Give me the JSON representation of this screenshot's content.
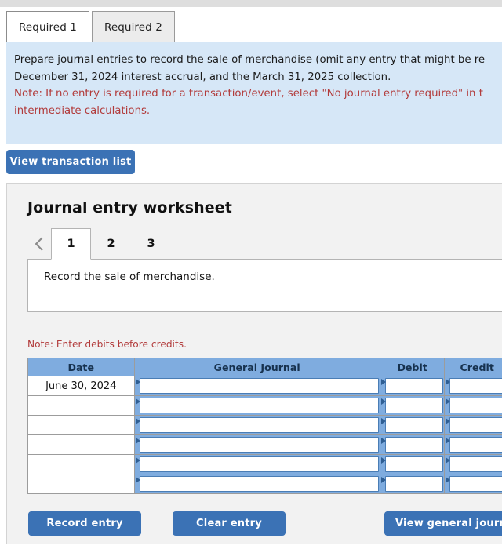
{
  "top_strip": {
    "color": "#dedede"
  },
  "required_tabs": [
    {
      "label": "Required 1",
      "active": true
    },
    {
      "label": "Required 2",
      "active": false
    }
  ],
  "instructions": {
    "background": "#d6e7f7",
    "line1": "Prepare journal entries to record the sale of merchandise (omit any entry that might be re",
    "line2": "December 31, 2024 interest accrual, and the March 31, 2025 collection.",
    "note_line1": "Note: If no entry is required for a transaction/event, select \"No journal entry required\" in t",
    "note_line2": "intermediate calculations.",
    "note_color": "#b23b3b"
  },
  "transaction_button": {
    "label": "View transaction list",
    "color": "#3b72b5"
  },
  "worksheet": {
    "title": "Journal entry worksheet",
    "chevron_icon": "chevron-left-icon",
    "number_tabs": [
      {
        "label": "1",
        "active": true
      },
      {
        "label": "2",
        "active": false
      },
      {
        "label": "3",
        "active": false
      }
    ],
    "description": "Record the sale of merchandise.",
    "note_debits": "Note: Enter debits before credits.",
    "table": {
      "headers": [
        "Date",
        "General Journal",
        "Debit",
        "Credit"
      ],
      "header_bg": "#7facdf",
      "rows": [
        {
          "date": "June 30, 2024",
          "general_journal": "",
          "debit": "",
          "credit": ""
        },
        {
          "date": "",
          "general_journal": "",
          "debit": "",
          "credit": ""
        },
        {
          "date": "",
          "general_journal": "",
          "debit": "",
          "credit": ""
        },
        {
          "date": "",
          "general_journal": "",
          "debit": "",
          "credit": ""
        },
        {
          "date": "",
          "general_journal": "",
          "debit": "",
          "credit": ""
        },
        {
          "date": "",
          "general_journal": "",
          "debit": "",
          "credit": ""
        }
      ]
    },
    "buttons": {
      "record": "Record entry",
      "clear": "Clear entry",
      "view_general_journal": "View general journ"
    }
  }
}
